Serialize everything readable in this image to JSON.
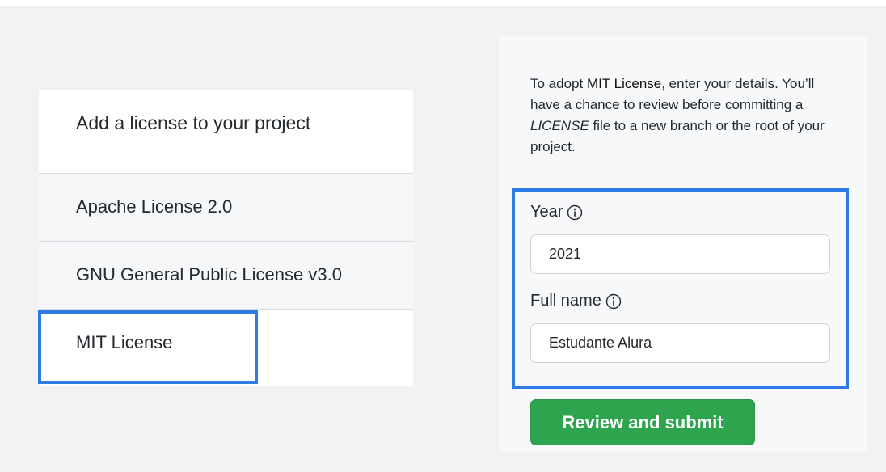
{
  "left_panel": {
    "title": "Add a license to your project",
    "licenses": [
      {
        "label": "Apache License 2.0"
      },
      {
        "label": "GNU General Public License v3.0"
      },
      {
        "label": "MIT License"
      }
    ]
  },
  "right_panel": {
    "intro": {
      "part1": "To adopt ",
      "license_name": "MIT License",
      "part2": ", enter your details. You’ll have a chance to review before committing a ",
      "file_name": "LICENSE",
      "part3": " file to a new branch or the root of your project."
    },
    "year": {
      "label": "Year",
      "value": "2021"
    },
    "full_name": {
      "label": "Full name",
      "value": "Estudante Alura"
    },
    "submit_label": "Review and submit"
  },
  "icons": {
    "info": "info-circle-icon"
  },
  "colors": {
    "highlight": "#2d7be5",
    "submit": "#2ea44f"
  }
}
